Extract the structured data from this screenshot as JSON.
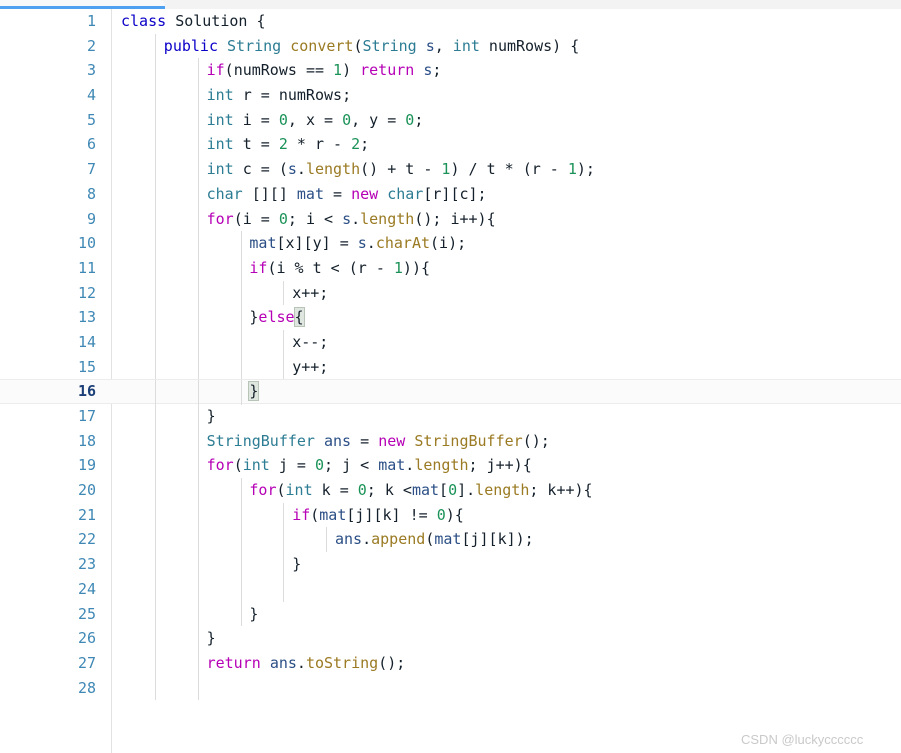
{
  "window": {
    "tab_accent_color": "#4ea0f0",
    "background_color": "#ffffff"
  },
  "editor": {
    "language": "java",
    "active_line": 16,
    "gutter": {
      "line_number_color": "#3f88b5",
      "active_line_number_color": "#1c3f77"
    },
    "syntax_colors": {
      "keyword": "#b600b6",
      "modifier": "#0a00c8",
      "type": "#2c7c93",
      "method": "#9a7a22",
      "variable": "#2b4f86",
      "number": "#1a9257",
      "plain": "#14202b",
      "brace_match_background": "#dfe6df"
    },
    "lines": [
      {
        "n": "1",
        "indent": 0,
        "text": "class Solution {"
      },
      {
        "n": "2",
        "indent": 1,
        "text": "public String convert(String s, int numRows) {"
      },
      {
        "n": "3",
        "indent": 2,
        "text": "if(numRows == 1) return s;"
      },
      {
        "n": "4",
        "indent": 2,
        "text": "int r = numRows;"
      },
      {
        "n": "5",
        "indent": 2,
        "text": "int i = 0, x = 0, y = 0;"
      },
      {
        "n": "6",
        "indent": 2,
        "text": "int t = 2 * r - 2;"
      },
      {
        "n": "7",
        "indent": 2,
        "text": "int c = (s.length() + t - 1) / t * (r - 1);"
      },
      {
        "n": "8",
        "indent": 2,
        "text": "char [][] mat = new char[r][c];"
      },
      {
        "n": "9",
        "indent": 2,
        "text": "for(i = 0; i < s.length(); i++){"
      },
      {
        "n": "10",
        "indent": 3,
        "text": "mat[x][y] = s.charAt(i);"
      },
      {
        "n": "11",
        "indent": 3,
        "text": "if(i % t < (r - 1)){"
      },
      {
        "n": "12",
        "indent": 4,
        "text": "x++;"
      },
      {
        "n": "13",
        "indent": 3,
        "text": "}else{"
      },
      {
        "n": "14",
        "indent": 4,
        "text": "x--;"
      },
      {
        "n": "15",
        "indent": 4,
        "text": "y++;"
      },
      {
        "n": "16",
        "indent": 3,
        "text": "}"
      },
      {
        "n": "17",
        "indent": 2,
        "text": "}"
      },
      {
        "n": "18",
        "indent": 2,
        "text": "StringBuffer ans = new StringBuffer();"
      },
      {
        "n": "19",
        "indent": 2,
        "text": "for(int j = 0; j < mat.length; j++){"
      },
      {
        "n": "20",
        "indent": 3,
        "text": "for(int k = 0; k <mat[0].length; k++){"
      },
      {
        "n": "21",
        "indent": 4,
        "text": "if(mat[j][k] != 0){"
      },
      {
        "n": "22",
        "indent": 5,
        "text": "ans.append(mat[j][k]);"
      },
      {
        "n": "23",
        "indent": 4,
        "text": "}"
      },
      {
        "n": "24",
        "indent": 4,
        "text": ""
      },
      {
        "n": "25",
        "indent": 3,
        "text": "}"
      },
      {
        "n": "26",
        "indent": 2,
        "text": "}"
      },
      {
        "n": "27",
        "indent": 2,
        "text": "return ans.toString();"
      },
      {
        "n": "28",
        "indent": 2,
        "text": ""
      }
    ]
  },
  "watermark": {
    "text": "CSDN @luckycccccc"
  }
}
